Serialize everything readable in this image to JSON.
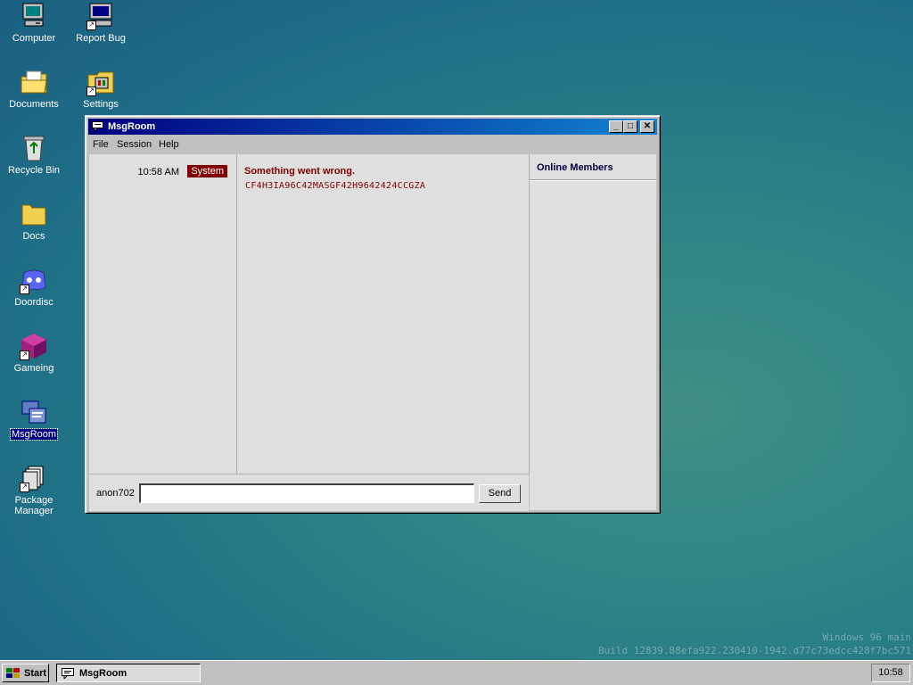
{
  "desktop": {
    "icons": [
      {
        "label": "Computer",
        "icon": "computer-icon"
      },
      {
        "label": "Report Bug",
        "icon": "report-bug-icon",
        "shortcut": true
      },
      {
        "label": "Documents",
        "icon": "documents-folder-icon"
      },
      {
        "label": "Settings",
        "icon": "settings-icon",
        "shortcut": true
      },
      {
        "label": "Recycle Bin",
        "icon": "recycle-bin-icon"
      },
      {
        "label": "Docs",
        "icon": "folder-icon"
      },
      {
        "label": "Doordisc",
        "icon": "doordisc-icon",
        "shortcut": true
      },
      {
        "label": "Gameing",
        "icon": "gameing-cube-icon",
        "shortcut": true
      },
      {
        "label": "MsgRoom",
        "icon": "msgroom-icon",
        "selected": true
      },
      {
        "label": "Package Manager",
        "icon": "package-manager-icon",
        "shortcut": true
      }
    ],
    "watermark": {
      "line1": "Windows 96 main",
      "line2": "Build 12839.88efa922.230410-1942.d77c73edcc428f7bc571"
    }
  },
  "window": {
    "title": "MsgRoom",
    "menu": [
      "File",
      "Session",
      "Help"
    ],
    "messages": [
      {
        "time": "10:58 AM",
        "sender": "System",
        "title": "Something went wrong.",
        "body": "CF4H3IA96C42MASGF42H9642424CCGZA"
      }
    ],
    "members_header": "Online Members",
    "username": "anon702",
    "input_value": "",
    "send_label": "Send"
  },
  "taskbar": {
    "start_label": "Start",
    "task_label": "MsgRoom",
    "clock": "10:58"
  },
  "colors": {
    "titlebar_start": "#000080",
    "titlebar_end": "#1084d0",
    "error": "#800000",
    "system_badge": "#800000"
  }
}
